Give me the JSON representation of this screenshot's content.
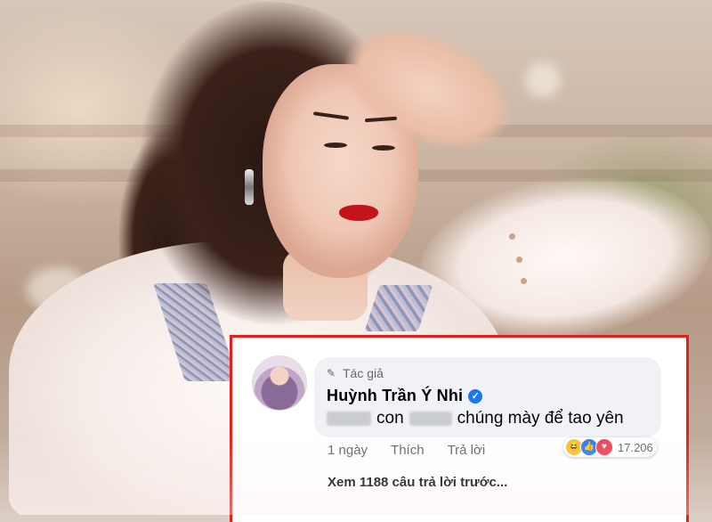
{
  "photo": {
    "subject": "",
    "accent": "#c3141c"
  },
  "comment": {
    "author_tag": "Tác giả",
    "author_name": "Huỳnh Trần Ý Nhi",
    "text_visible": [
      "con",
      "chúng mày để tao yên"
    ],
    "time": "1 ngày",
    "like_label": "Thích",
    "reply_label": "Trả lời",
    "reaction_count": "17.206",
    "reactions": [
      "haha-icon",
      "like-icon",
      "love-icon"
    ],
    "more_replies": "Xem 1188 câu trả lời trước..."
  },
  "colors": {
    "frame": "#e2211c",
    "bubble": "#f0f2f5",
    "verified": "#1877f2"
  }
}
